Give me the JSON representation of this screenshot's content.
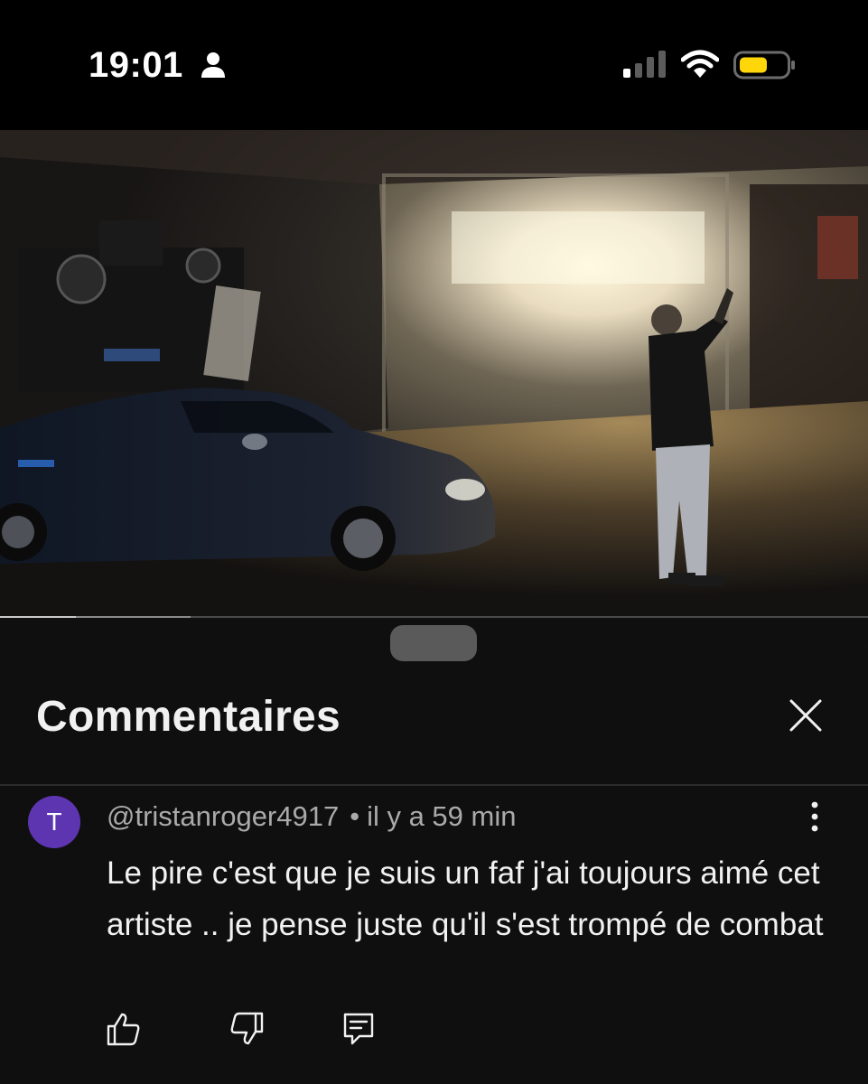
{
  "status_bar": {
    "time": "19:01",
    "icons": [
      "person-icon",
      "cellular-signal-icon",
      "wifi-icon",
      "battery-icon"
    ],
    "battery_color": "#ffd60a"
  },
  "video": {
    "progress_played_fraction": 0.087,
    "progress_buffered_fraction": 0.22
  },
  "comments_panel": {
    "title": "Commentaires",
    "close_icon": "close-icon",
    "comments": [
      {
        "avatar_letter": "T",
        "avatar_color": "#5e35b1",
        "author": "@tristanroger4917",
        "separator": "•",
        "time": "il y a 59 min",
        "text": "Le pire c'est que je suis un faf j'ai toujours aimé cet artiste .. je pense juste qu'il s'est trompé de combat",
        "actions": [
          "thumbs-up-icon",
          "thumbs-down-icon",
          "reply-icon"
        ]
      }
    ]
  }
}
